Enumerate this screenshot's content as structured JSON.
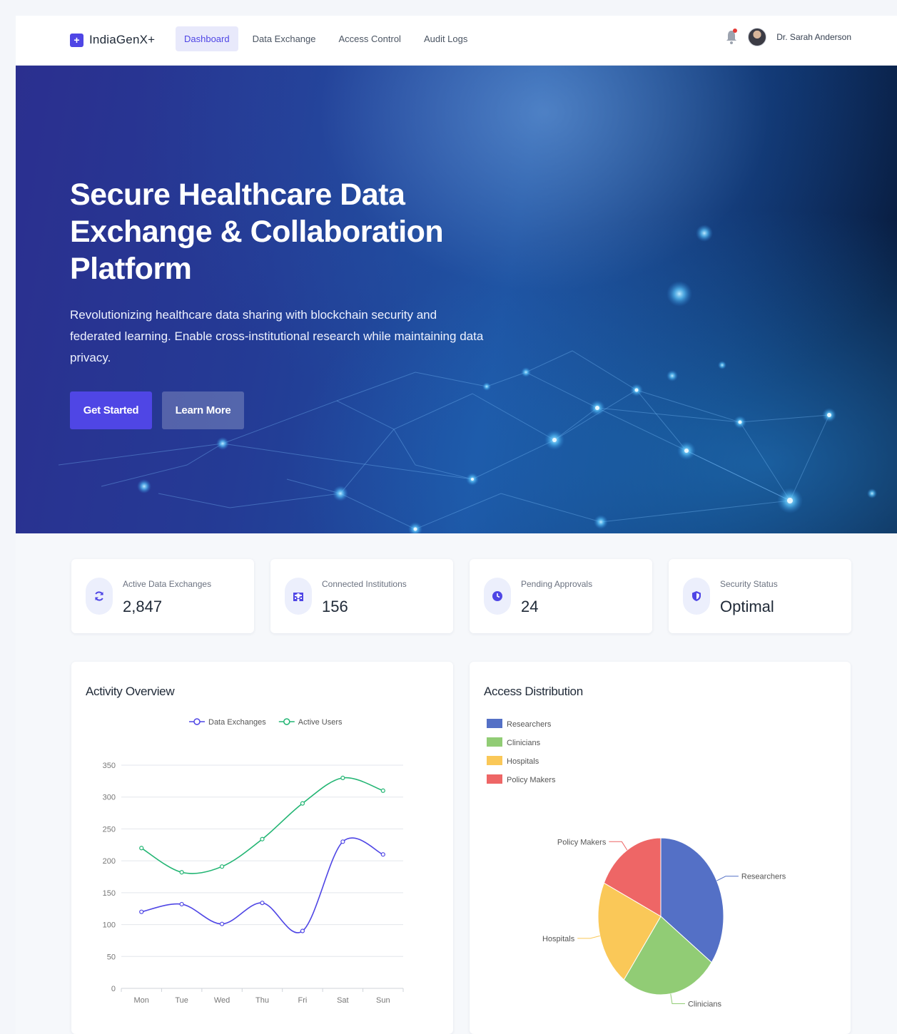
{
  "nav": {
    "brand_icon": "plus-square-icon",
    "brand": "IndiaGenX+",
    "links": [
      "Dashboard",
      "Data Exchange",
      "Access Control",
      "Audit Logs"
    ],
    "active_link": "Dashboard",
    "user_name": "Dr. Sarah Anderson",
    "notification_icon": "bell-icon"
  },
  "hero": {
    "title": "Secure Healthcare Data Exchange & Collaboration Platform",
    "subtitle": "Revolutionizing healthcare data sharing with blockchain security and federated learning. Enable cross-institutional research while maintaining data privacy.",
    "primary_button": "Get Started",
    "secondary_button": "Learn More"
  },
  "stats": [
    {
      "label": "Active Data Exchanges",
      "value": "2,847",
      "icon": "sync-icon"
    },
    {
      "label": "Connected Institutions",
      "value": "156",
      "icon": "hospital-icon"
    },
    {
      "label": "Pending Approvals",
      "value": "24",
      "icon": "clock-icon"
    },
    {
      "label": "Security Status",
      "value": "Optimal",
      "icon": "shield-icon"
    }
  ],
  "colors": {
    "accent": "#4f46e5",
    "series_exchanges": "#4f46e5",
    "series_users": "#22b573",
    "pie_researchers": "#5470c6",
    "pie_clinicians": "#91cc75",
    "pie_hospitals": "#fac858",
    "pie_policy": "#ee6666"
  },
  "panels": {
    "activity_title": "Activity Overview",
    "access_title": "Access Distribution"
  },
  "chart_data": [
    {
      "type": "line",
      "categories": [
        "Mon",
        "Tue",
        "Wed",
        "Thu",
        "Fri",
        "Sat",
        "Sun"
      ],
      "series": [
        {
          "name": "Data Exchanges",
          "values": [
            120,
            132,
            101,
            134,
            90,
            230,
            210
          ]
        },
        {
          "name": "Active Users",
          "values": [
            220,
            182,
            191,
            234,
            290,
            330,
            310
          ]
        }
      ],
      "ylim": [
        0,
        350
      ],
      "yticks": [
        0,
        50,
        100,
        150,
        200,
        250,
        300,
        350
      ],
      "grid": true,
      "legend": "top-center",
      "smooth": true
    },
    {
      "type": "pie",
      "labels": [
        "Researchers",
        "Clinicians",
        "Hospitals",
        "Policy Makers"
      ],
      "values": [
        35,
        25,
        22,
        18
      ],
      "legend": "top-left"
    }
  ]
}
